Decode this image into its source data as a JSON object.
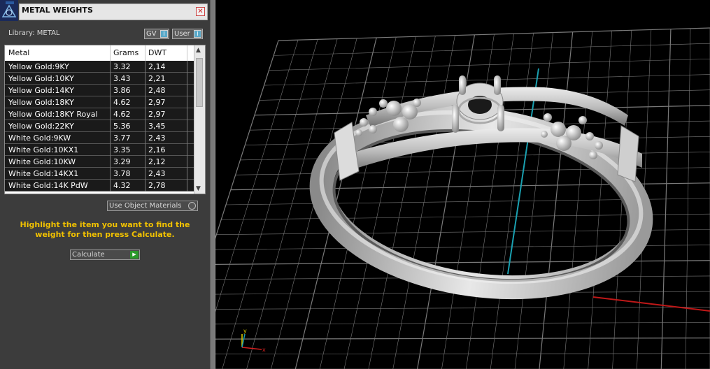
{
  "panel": {
    "title": "METAL WEIGHTS",
    "close_glyph": "✕",
    "library_label": "Library: METAL",
    "tags": [
      {
        "label": "GV",
        "indicator": "I"
      },
      {
        "label": "User",
        "indicator": "I"
      }
    ],
    "table": {
      "headers": [
        "Metal",
        "Grams",
        "DWT"
      ],
      "rows": [
        [
          "Yellow Gold:9KY",
          "3.32",
          "2,14"
        ],
        [
          "Yellow Gold:10KY",
          "3.43",
          "2,21"
        ],
        [
          "Yellow Gold:14KY",
          "3.86",
          "2,48"
        ],
        [
          "Yellow Gold:18KY",
          "4.62",
          "2,97"
        ],
        [
          "Yellow Gold:18KY Royal",
          "4.62",
          "2,97"
        ],
        [
          "Yellow Gold:22KY",
          "5.36",
          "3,45"
        ],
        [
          "White Gold:9KW",
          "3.77",
          "2,43"
        ],
        [
          "White Gold:10KX1",
          "3.35",
          "2,16"
        ],
        [
          "White Gold:10KW",
          "3.29",
          "2,12"
        ],
        [
          "White Gold:14KX1",
          "3.78",
          "2,43"
        ],
        [
          "White Gold:14K PdW",
          "4.32",
          "2,78"
        ]
      ]
    },
    "use_object_materials": "Use Object Materials",
    "instructions": "Highlight the item you want to find the weight for then press Calculate.",
    "calculate_label": "Calculate",
    "calculate_glyph": "▶"
  },
  "viewport": {
    "axis_colors": {
      "x": "#d42020",
      "y": "#1aa0b0",
      "grid": "#7a7a7a"
    },
    "axis_gizmo_labels": {
      "x": "x",
      "y": "y"
    }
  }
}
